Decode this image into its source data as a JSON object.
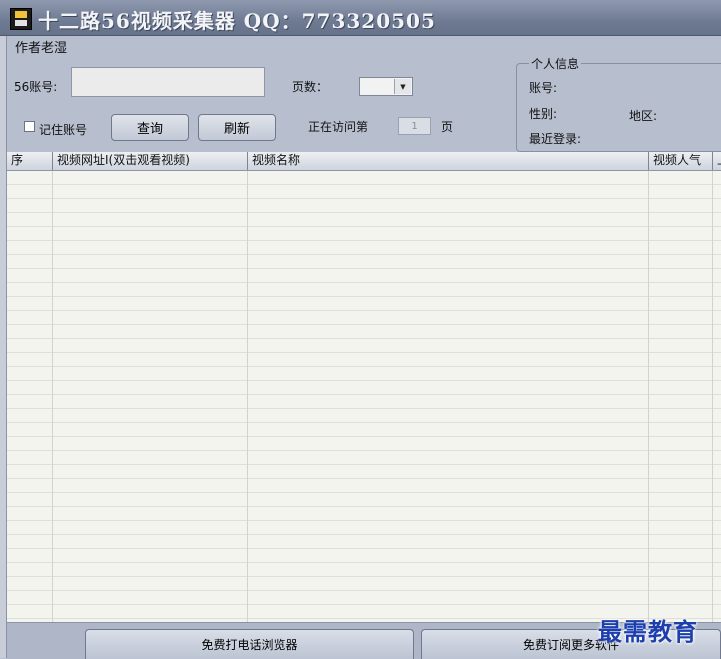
{
  "window": {
    "title": "十二路56视频采集器  QQ：773320505",
    "icon": "film-app-icon"
  },
  "form": {
    "author_label": "作者老湿",
    "account_label": "56账号:",
    "account_value": "",
    "pages_label": "页数：",
    "pages_value": "",
    "remember_label": "记住账号",
    "remember_checked": false,
    "query_button": "查询",
    "refresh_button": "刷新",
    "visiting_label": "正在访问第",
    "visiting_page": "1",
    "page_suffix": "页"
  },
  "info": {
    "legend": "个人信息",
    "account_label": "账号:",
    "gender_label": "性别:",
    "region_label": "地区:",
    "last_login_label": "最近登录:"
  },
  "table": {
    "columns": [
      "序",
      "视频网址I(双击观看视频)",
      "视频名称",
      "视频人气",
      "上"
    ],
    "rows": []
  },
  "footer": {
    "browser_button": "免费打电话浏览器",
    "subscribe_button": "免费订阅更多软件"
  },
  "watermark": "最需教育",
  "colors": {
    "titlebar": "#6f7b93",
    "panel": "#b7bfcf",
    "watermark": "#1d3fae"
  }
}
